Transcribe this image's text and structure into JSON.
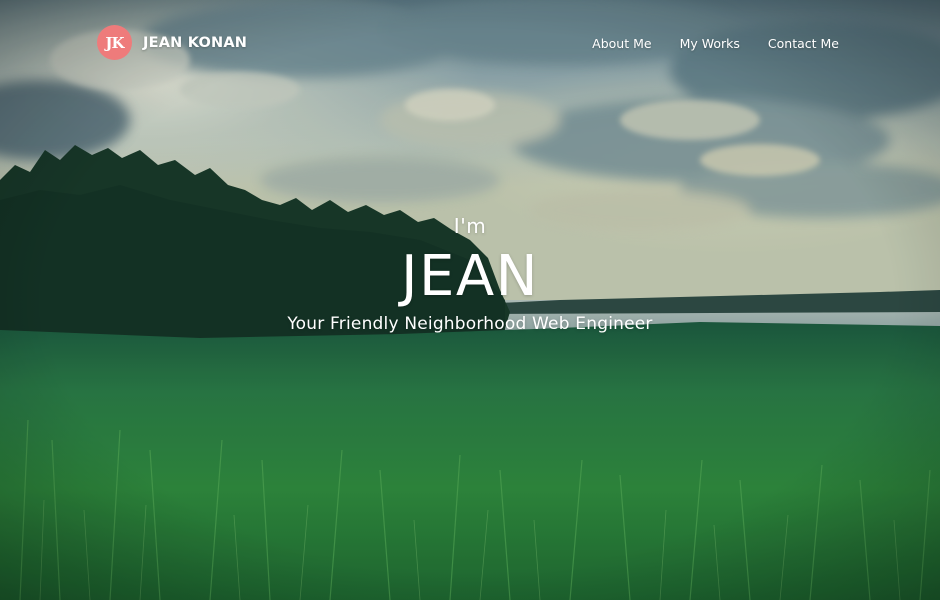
{
  "brand": {
    "logo_text": "JK",
    "name": "JEAN KONAN",
    "logo_color": "#ee7b7b"
  },
  "nav": {
    "items": [
      {
        "label": "About Me"
      },
      {
        "label": "My Works"
      },
      {
        "label": "Contact Me"
      }
    ]
  },
  "hero": {
    "intro": "I'm",
    "name": "JEAN",
    "tagline": "Your Friendly Neighborhood Web Engineer",
    "background": "landscape-photo"
  }
}
